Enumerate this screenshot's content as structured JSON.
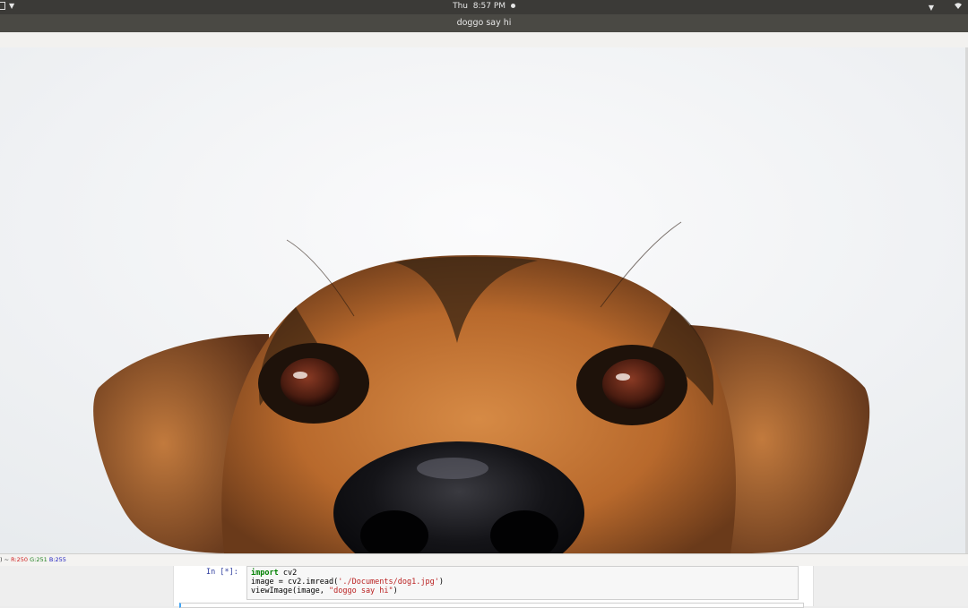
{
  "topbar": {
    "day": "Thu",
    "time": "8:57 PM",
    "activities_icon": "window-icon",
    "tray_icons": [
      "chevron-down-icon",
      "wifi-icon"
    ]
  },
  "window": {
    "title": "doggo say hi"
  },
  "image": {
    "subject": "dog-peeking-photo"
  },
  "statusbar": {
    "prefix": ") ~",
    "r_label": "R:250",
    "g_label": "G:251",
    "b_label": "B:255"
  },
  "notebook": {
    "prompt": "In [*]:",
    "code_lines": [
      {
        "kw": "import",
        "rest": " cv2"
      },
      {
        "pre": "image = cv2.imread(",
        "str": "'./Documents/dog1.jpg'",
        "post": ")"
      },
      {
        "pre": "viewImage(image, ",
        "str": "\"doggo say hi\"",
        "post": ")"
      }
    ]
  },
  "colors": {
    "topbar": "#3b3a37",
    "titlebar": "#4a4944",
    "prompt_blue": "#303f9f",
    "keyword_green": "#008000",
    "string_red": "#ba2121"
  }
}
